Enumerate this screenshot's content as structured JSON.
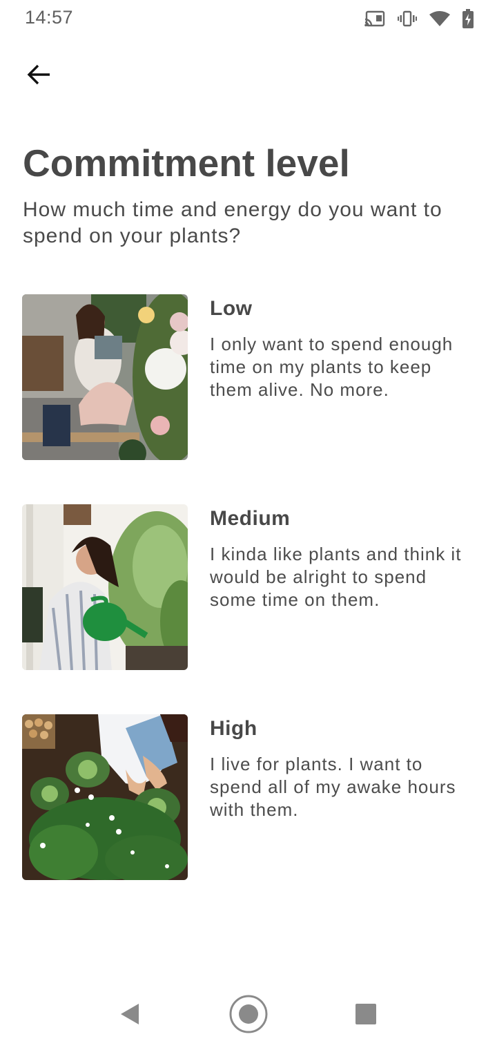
{
  "status_bar": {
    "time": "14:57",
    "icons": [
      "cast-icon",
      "vibrate-icon",
      "wifi-icon",
      "battery-charging-icon"
    ]
  },
  "toolbar": {
    "back_icon": "arrow-back-icon"
  },
  "header": {
    "title": "Commitment level",
    "subtitle": "How much time and energy do you want to spend on your plants?"
  },
  "options": [
    {
      "title": "Low",
      "description": "I only want to spend enough time on my plants to keep them alive. No more."
    },
    {
      "title": "Medium",
      "description": "I kinda like plants and think it would be alright to spend some time on them."
    },
    {
      "title": "High",
      "description": "I live for plants. I want to spend all of my awake hours with them."
    }
  ],
  "nav_bar": {
    "icons": [
      "back-triangle-icon",
      "home-circle-icon",
      "recents-square-icon"
    ]
  },
  "colors": {
    "text_primary": "#484848",
    "text_secondary": "#4c4c4c",
    "background": "#ffffff",
    "nav_icon": "#8a8a8a"
  }
}
